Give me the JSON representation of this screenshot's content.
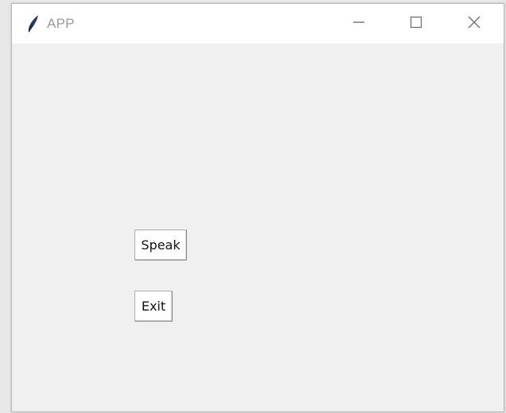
{
  "window": {
    "title": "APP",
    "icons": {
      "app": "feather-icon",
      "minimize": "minimize-icon",
      "maximize": "maximize-icon",
      "close": "close-icon"
    }
  },
  "buttons": {
    "speak_label": "Speak",
    "exit_label": "Exit"
  },
  "colors": {
    "window_background": "#f0f0f0",
    "titlebar_background": "#ffffff",
    "title_text": "#999999",
    "button_background": "#ffffff"
  }
}
